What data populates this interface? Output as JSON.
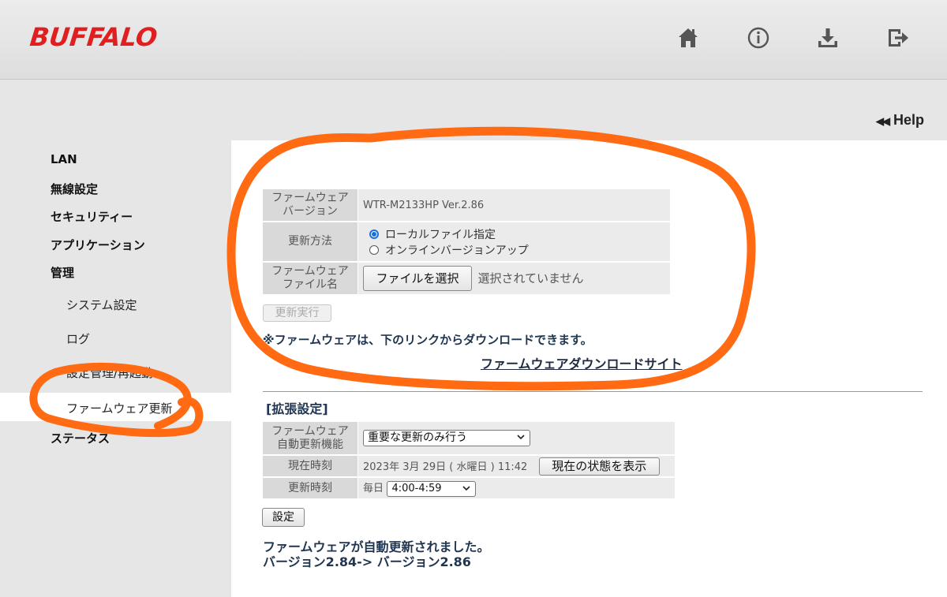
{
  "brand": {
    "logo_text": "BUFFALO",
    "logo_color": "#e02020"
  },
  "header": {
    "icons": [
      "home-icon",
      "info-icon",
      "download-icon",
      "logout-icon"
    ],
    "icon_color": "#555555"
  },
  "help": {
    "arrows": "◀◀",
    "label": "Help"
  },
  "sidebar": {
    "items": [
      {
        "label": "LAN"
      },
      {
        "label": "無線設定"
      },
      {
        "label": "セキュリティー"
      },
      {
        "label": "アプリケーション"
      },
      {
        "label": "管理"
      },
      {
        "label": "ステータス"
      }
    ],
    "sub_items": [
      {
        "label": "システム設定"
      },
      {
        "label": "ログ"
      },
      {
        "label": "設定管理/再起動"
      },
      {
        "label": "ファームウェア更新",
        "active": true
      }
    ]
  },
  "firmware": {
    "version_label_1": "ファームウェア",
    "version_label_2": "バージョン",
    "version_value": "WTR-M2133HP Ver.2.86",
    "method_label": "更新方法",
    "method_options": [
      "ローカルファイル指定",
      "オンラインバージョンアップ"
    ],
    "method_selected": "ローカルファイル指定",
    "file_label_1": "ファームウェア",
    "file_label_2": "ファイル名",
    "file_button": "ファイルを選択",
    "file_status": "選択されていません",
    "execute_button": "更新実行",
    "notice": "※ファームウェアは、下のリンクからダウンロードできます。",
    "download_link": "ファームウェアダウンロードサイト"
  },
  "advanced": {
    "title": "[拡張設定]",
    "auto_update_label_1": "ファームウェア",
    "auto_update_label_2": "自動更新機能",
    "auto_update_value": "重要な更新のみ行う",
    "current_time_label": "現在時刻",
    "current_time_value": "2023年 3月 29日 ( 水曜日 )  11:42",
    "status_button": "現在の状態を表示",
    "update_time_label": "更新時刻",
    "update_time_prefix": "毎日",
    "update_time_value": "4:00-4:59",
    "save_button": "設定"
  },
  "message": {
    "line1": "ファームウェアが自動更新されました。",
    "line2": "バージョン2.84-> バージョン2.86"
  },
  "colors": {
    "annotation": "#ff6a13",
    "radio_accent": "#1a6fdc"
  }
}
